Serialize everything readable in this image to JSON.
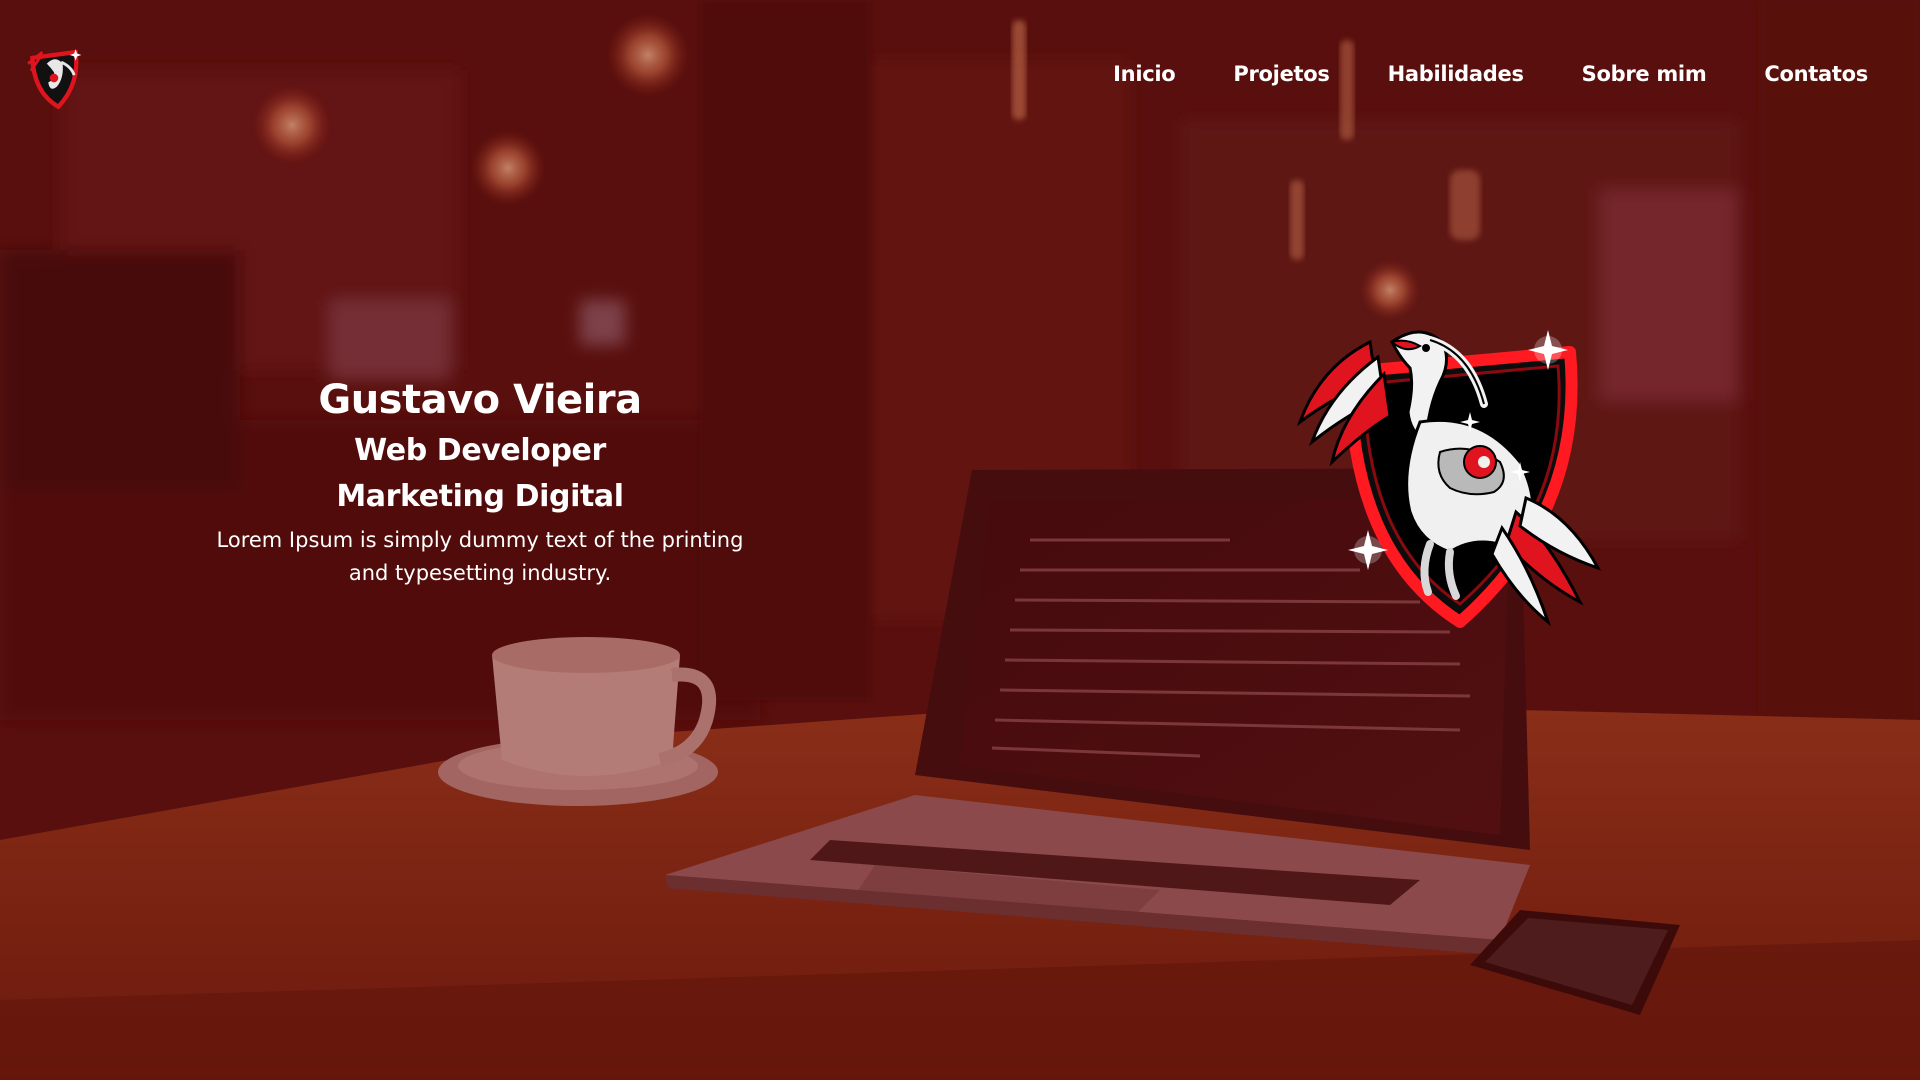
{
  "header": {
    "logo_icon": "ibis-shield-logo-icon",
    "nav": [
      {
        "label": "Inicio"
      },
      {
        "label": "Projetos"
      },
      {
        "label": "Habilidades"
      },
      {
        "label": "Sobre mim"
      },
      {
        "label": "Contatos"
      }
    ]
  },
  "hero": {
    "name": "Gustavo Vieira",
    "role_1": "Web Developer",
    "role_2": "Marketing Digital",
    "description": "Lorem Ipsum is simply dummy text of the printing and typesetting industry.",
    "emblem_icon": "ibis-shield-emblem-icon"
  },
  "colors": {
    "overlay": "#6e0a0a",
    "accent_red": "#e0141e",
    "text": "#ffffff"
  }
}
